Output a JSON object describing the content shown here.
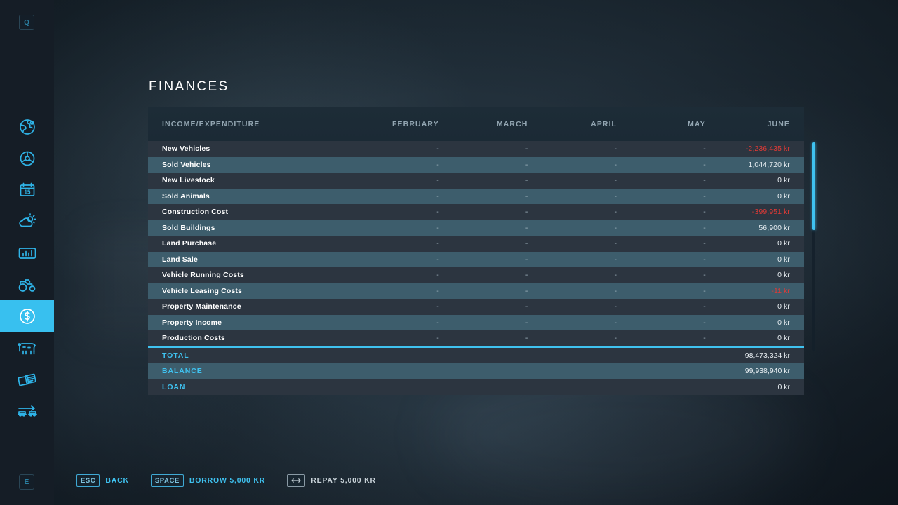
{
  "page": {
    "title": "FINANCES"
  },
  "corner_keys": {
    "prev": "Q",
    "next": "E"
  },
  "sidebar": {
    "items": [
      {
        "name": "map",
        "icon": "globe-icon",
        "active": false
      },
      {
        "name": "vehicles",
        "icon": "steering-wheel-icon",
        "active": false
      },
      {
        "name": "calendar",
        "icon": "calendar-icon",
        "active": false,
        "day": "15"
      },
      {
        "name": "weather",
        "icon": "weather-icon",
        "active": false
      },
      {
        "name": "statistics",
        "icon": "bar-chart-icon",
        "active": false
      },
      {
        "name": "machines",
        "icon": "tractor-icon",
        "active": false
      },
      {
        "name": "finances",
        "icon": "dollar-coin-icon",
        "active": true
      },
      {
        "name": "animals",
        "icon": "cow-icon",
        "active": false
      },
      {
        "name": "contracts",
        "icon": "documents-icon",
        "active": false
      },
      {
        "name": "production",
        "icon": "production-chain-icon",
        "active": false
      }
    ]
  },
  "table": {
    "headers": [
      "INCOME/EXPENDITURE",
      "FEBRUARY",
      "MARCH",
      "APRIL",
      "MAY",
      "JUNE"
    ],
    "rows": [
      {
        "label": "New Vehicles",
        "values": [
          "-",
          "-",
          "-",
          "-",
          "-2,236,435 kr"
        ],
        "negative": [
          false,
          false,
          false,
          false,
          true
        ]
      },
      {
        "label": "Sold Vehicles",
        "values": [
          "-",
          "-",
          "-",
          "-",
          "1,044,720 kr"
        ],
        "negative": [
          false,
          false,
          false,
          false,
          false
        ]
      },
      {
        "label": "New Livestock",
        "values": [
          "-",
          "-",
          "-",
          "-",
          "0 kr"
        ],
        "negative": [
          false,
          false,
          false,
          false,
          false
        ]
      },
      {
        "label": "Sold Animals",
        "values": [
          "-",
          "-",
          "-",
          "-",
          "0 kr"
        ],
        "negative": [
          false,
          false,
          false,
          false,
          false
        ]
      },
      {
        "label": "Construction Cost",
        "values": [
          "-",
          "-",
          "-",
          "-",
          "-399,951 kr"
        ],
        "negative": [
          false,
          false,
          false,
          false,
          true
        ]
      },
      {
        "label": "Sold Buildings",
        "values": [
          "-",
          "-",
          "-",
          "-",
          "56,900 kr"
        ],
        "negative": [
          false,
          false,
          false,
          false,
          false
        ]
      },
      {
        "label": "Land Purchase",
        "values": [
          "-",
          "-",
          "-",
          "-",
          "0 kr"
        ],
        "negative": [
          false,
          false,
          false,
          false,
          false
        ]
      },
      {
        "label": "Land Sale",
        "values": [
          "-",
          "-",
          "-",
          "-",
          "0 kr"
        ],
        "negative": [
          false,
          false,
          false,
          false,
          false
        ]
      },
      {
        "label": "Vehicle Running Costs",
        "values": [
          "-",
          "-",
          "-",
          "-",
          "0 kr"
        ],
        "negative": [
          false,
          false,
          false,
          false,
          false
        ]
      },
      {
        "label": "Vehicle Leasing Costs",
        "values": [
          "-",
          "-",
          "-",
          "-",
          "-11 kr"
        ],
        "negative": [
          false,
          false,
          false,
          false,
          true
        ]
      },
      {
        "label": "Property Maintenance",
        "values": [
          "-",
          "-",
          "-",
          "-",
          "0 kr"
        ],
        "negative": [
          false,
          false,
          false,
          false,
          false
        ]
      },
      {
        "label": "Property Income",
        "values": [
          "-",
          "-",
          "-",
          "-",
          "0 kr"
        ],
        "negative": [
          false,
          false,
          false,
          false,
          false
        ]
      },
      {
        "label": "Production Costs",
        "values": [
          "-",
          "-",
          "-",
          "-",
          "0 kr"
        ],
        "negative": [
          false,
          false,
          false,
          false,
          false
        ]
      }
    ],
    "summary": [
      {
        "label": "TOTAL",
        "value": "98,473,324 kr"
      },
      {
        "label": "BALANCE",
        "value": "99,938,940 kr"
      },
      {
        "label": "LOAN",
        "value": "0 kr"
      }
    ]
  },
  "actions": [
    {
      "key": "ESC",
      "label": "BACK",
      "style": "blue",
      "icon": null
    },
    {
      "key": "SPACE",
      "label": "BORROW 5,000 KR",
      "style": "blue",
      "icon": null
    },
    {
      "key": "",
      "label": "REPAY 5,000 KR",
      "style": "grey",
      "icon": "left-right-arrow-icon"
    }
  ],
  "colors": {
    "accent": "#3fc2f0",
    "negative": "#e03a36",
    "row_odd": "#2c3540",
    "row_even": "#3d5d6c",
    "sidebar_bg": "#151d26"
  }
}
